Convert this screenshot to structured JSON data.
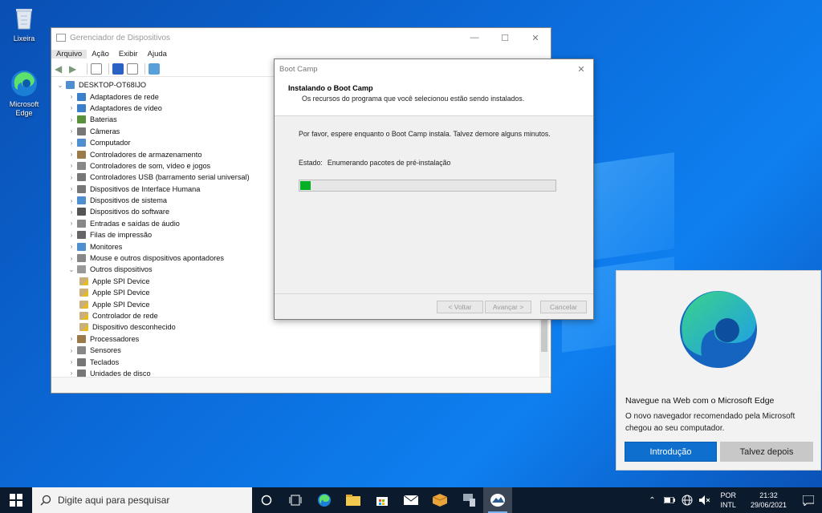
{
  "desktop": {
    "icons": [
      {
        "label": "Lixeira",
        "icon": "recycle-bin-icon"
      },
      {
        "label": "Microsoft Edge",
        "icon": "edge-icon"
      }
    ]
  },
  "device_manager": {
    "title": "Gerenciador de Dispositivos",
    "menu": [
      "Arquivo",
      "Ação",
      "Exibir",
      "Ajuda"
    ],
    "root": "DESKTOP-OT68IJO",
    "tree": [
      {
        "label": "Adaptadores de rede",
        "level": 1,
        "expanded": false
      },
      {
        "label": "Adaptadores de vídeo",
        "level": 1,
        "expanded": false
      },
      {
        "label": "Baterias",
        "level": 1,
        "expanded": false
      },
      {
        "label": "Câmeras",
        "level": 1,
        "expanded": false
      },
      {
        "label": "Computador",
        "level": 1,
        "expanded": false
      },
      {
        "label": "Controladores de armazenamento",
        "level": 1,
        "expanded": false
      },
      {
        "label": "Controladores de som, vídeo e jogos",
        "level": 1,
        "expanded": false
      },
      {
        "label": "Controladores USB (barramento serial universal)",
        "level": 1,
        "expanded": false
      },
      {
        "label": "Dispositivos de Interface Humana",
        "level": 1,
        "expanded": false
      },
      {
        "label": "Dispositivos de sistema",
        "level": 1,
        "expanded": false
      },
      {
        "label": "Dispositivos do software",
        "level": 1,
        "expanded": false
      },
      {
        "label": "Entradas e saídas de áudio",
        "level": 1,
        "expanded": false
      },
      {
        "label": "Filas de impressão",
        "level": 1,
        "expanded": false
      },
      {
        "label": "Monitores",
        "level": 1,
        "expanded": false
      },
      {
        "label": "Mouse e outros dispositivos apontadores",
        "level": 1,
        "expanded": false
      },
      {
        "label": "Outros dispositivos",
        "level": 1,
        "expanded": true
      },
      {
        "label": "Apple SPI Device",
        "level": 2,
        "warning": true
      },
      {
        "label": "Apple SPI Device",
        "level": 2,
        "warning": true
      },
      {
        "label": "Apple SPI Device",
        "level": 2,
        "warning": true
      },
      {
        "label": "Controlador de rede",
        "level": 2,
        "warning": true
      },
      {
        "label": "Dispositivo desconhecido",
        "level": 2,
        "warning": true
      },
      {
        "label": "Processadores",
        "level": 1,
        "expanded": false
      },
      {
        "label": "Sensores",
        "level": 1,
        "expanded": false
      },
      {
        "label": "Teclados",
        "level": 1,
        "expanded": false
      },
      {
        "label": "Unidades de disco",
        "level": 1,
        "expanded": false
      }
    ]
  },
  "bootcamp": {
    "title": "Boot Camp",
    "heading": "Instalando o Boot Camp",
    "subheading": "Os recursos do programa que você selecionou estão sendo instalados.",
    "message": "Por favor, espere enquanto o Boot Camp instala. Talvez demore alguns minutos.",
    "state_label": "Estado:",
    "state_value": "Enumerando pacotes de pré-instalação",
    "progress": 0.04,
    "buttons": {
      "back": "< Voltar",
      "next": "Avançar >",
      "cancel": "Cancelar"
    }
  },
  "edge_notification": {
    "title": "Navegue na Web com o Microsoft  Edge",
    "text": "O novo navegador recomendado pela Microsoft chegou ao seu computador.",
    "primary": "Introdução",
    "secondary": "Talvez depois"
  },
  "taskbar": {
    "search_placeholder": "Digite aqui para pesquisar",
    "apps": [
      "cortana-icon",
      "task-view-icon",
      "edge-icon",
      "file-explorer-icon",
      "store-icon",
      "mail-icon",
      "bootcamp-package-icon",
      "device-manager-icon",
      "bootcamp-icon"
    ],
    "lang_top": "POR",
    "lang_bottom": "INTL",
    "time": "21:32",
    "date": "29/06/2021"
  }
}
